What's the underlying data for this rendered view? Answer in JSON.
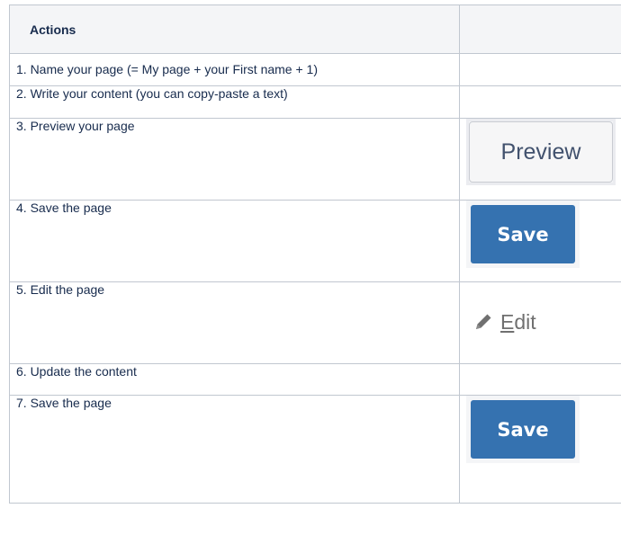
{
  "table": {
    "header": {
      "actions": "Actions",
      "second": ""
    },
    "rows": [
      {
        "step": "1. Name your page (= My page + your First name + 1)"
      },
      {
        "step": "2. Write your content (you can copy-paste a text)"
      },
      {
        "step": "3. Preview your page",
        "button": "Preview"
      },
      {
        "step": "4. Save the page",
        "button": "Save"
      },
      {
        "step": "5. Edit the page",
        "button_first": "E",
        "button_rest": "dit",
        "icon": "pencil-icon"
      },
      {
        "step": "6. Update the content"
      },
      {
        "step": "7. Save the page",
        "button": "Save"
      }
    ]
  },
  "colors": {
    "save_blue": "#3572b0",
    "header_bg": "#f4f5f7",
    "border": "#c1c7d0"
  }
}
